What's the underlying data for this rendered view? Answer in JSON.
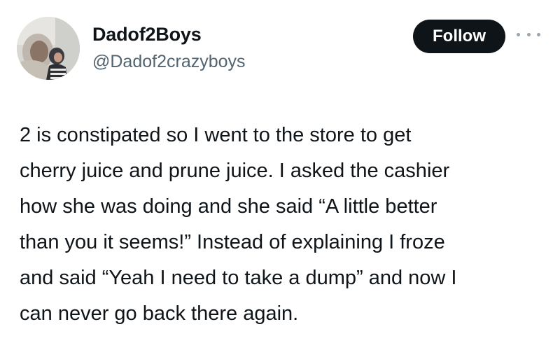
{
  "author": {
    "display_name": "Dadof2Boys",
    "handle": "@Dadof2crazyboys",
    "avatar_icon": "profile-photo"
  },
  "actions": {
    "follow_label": "Follow",
    "more_icon": "more-options-icon"
  },
  "post": {
    "lines": [
      "2 is constipated so I went to the store to get",
      "cherry juice and prune juice. I asked the cashier",
      "how she was doing and she said “A little better",
      "than you it seems!” Instead of explaining I froze",
      "and said “Yeah I need to take a dump” and now I",
      "can never go back there again."
    ]
  },
  "colors": {
    "text": "#0f1419",
    "secondary_text": "#536471",
    "button_bg": "#0f1419",
    "button_text": "#ffffff"
  }
}
